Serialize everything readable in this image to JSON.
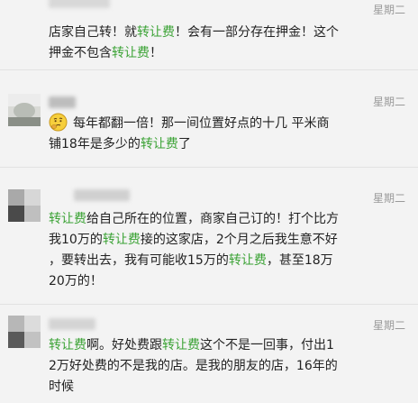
{
  "comments": [
    {
      "timestamp": "星期二",
      "lines": [
        [
          {
            "t": "店家自己转！就"
          },
          {
            "t": "转让费",
            "kw": true
          },
          {
            "t": "！会有一部分存在押金！这个"
          }
        ],
        [
          {
            "t": "押金不包含"
          },
          {
            "t": "转让费",
            "kw": true
          },
          {
            "t": "！"
          }
        ]
      ]
    },
    {
      "timestamp": "星期二",
      "emoji": "thinking-face",
      "lines": [
        [
          {
            "t": "每年都翻一倍！那一间位置好点的十几 平米商"
          }
        ],
        [
          {
            "t": "铺18年是多少的"
          },
          {
            "t": "转让费",
            "kw": true
          },
          {
            "t": "了"
          }
        ]
      ]
    },
    {
      "timestamp": "星期二",
      "lines": [
        [
          {
            "t": "转让费",
            "kw": true
          },
          {
            "t": "给自己所在的位置，商家自己订的！打个比方"
          }
        ],
        [
          {
            "t": "我10万的"
          },
          {
            "t": "转让费",
            "kw": true
          },
          {
            "t": "接的这家店，2个月之后我生意不好"
          }
        ],
        [
          {
            "t": "，要转出去，我有可能收15万的"
          },
          {
            "t": "转让费",
            "kw": true
          },
          {
            "t": "，甚至18万"
          }
        ],
        [
          {
            "t": "20万的！"
          }
        ]
      ]
    },
    {
      "timestamp": "星期二",
      "lines": [
        [
          {
            "t": "转让费",
            "kw": true
          },
          {
            "t": "啊。好处费跟"
          },
          {
            "t": "转让费",
            "kw": true
          },
          {
            "t": "这个不是一回事，付出1"
          }
        ],
        [
          {
            "t": "2万好处费的不是我的店。是我的朋友的店，16年的"
          }
        ],
        [
          {
            "t": "时候"
          }
        ]
      ]
    }
  ]
}
